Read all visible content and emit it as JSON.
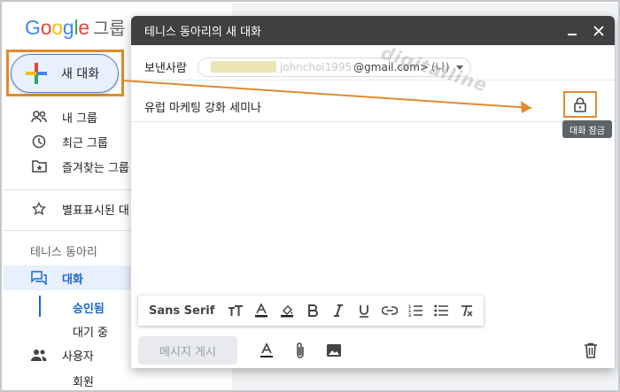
{
  "logo": {
    "letters": [
      {
        "ch": "G",
        "color": "#4285f4"
      },
      {
        "ch": "o",
        "color": "#ea4335"
      },
      {
        "ch": "o",
        "color": "#fbbc04"
      },
      {
        "ch": "g",
        "color": "#4285f4"
      },
      {
        "ch": "l",
        "color": "#34a853"
      },
      {
        "ch": "e",
        "color": "#ea4335"
      }
    ],
    "suffix": "그룹"
  },
  "sidebar": {
    "new_button_label": "새 대화",
    "items": [
      {
        "label": "내 그룹",
        "icon": "people-icon"
      },
      {
        "label": "최근 그룹",
        "icon": "clock-icon"
      },
      {
        "label": "즐겨찾는 그룹",
        "icon": "star-folder-icon"
      },
      {
        "label": "별표표시된 대",
        "icon": "star-icon"
      }
    ],
    "group_name": "테니스 동아리",
    "group_items": [
      {
        "label": "대화",
        "icon": "forum-icon",
        "active": true
      },
      {
        "label": "사용자",
        "icon": "people-icon",
        "active": false
      }
    ],
    "conversation_sub": [
      "승인됨",
      "대기 중"
    ],
    "people_sub": [
      "회원"
    ]
  },
  "compose": {
    "title": "테니스 동아리의 새 대화",
    "to_label": "보낸사람",
    "to_blur": "johnchoi1995",
    "to_email": "@gmail.com>",
    "to_me": "(나)",
    "subject": "유럽 마케팅 강화 세미나",
    "lock_tooltip": "대화 잠금",
    "font_name": "Sans Serif",
    "post_button": "메시지 게시"
  },
  "watermark": "digitalline",
  "colors": {
    "header_bg": "#404040",
    "annotation": "#e08a2f",
    "active_blue": "#1967d2",
    "nav_active_bg": "#e8f0fe"
  }
}
